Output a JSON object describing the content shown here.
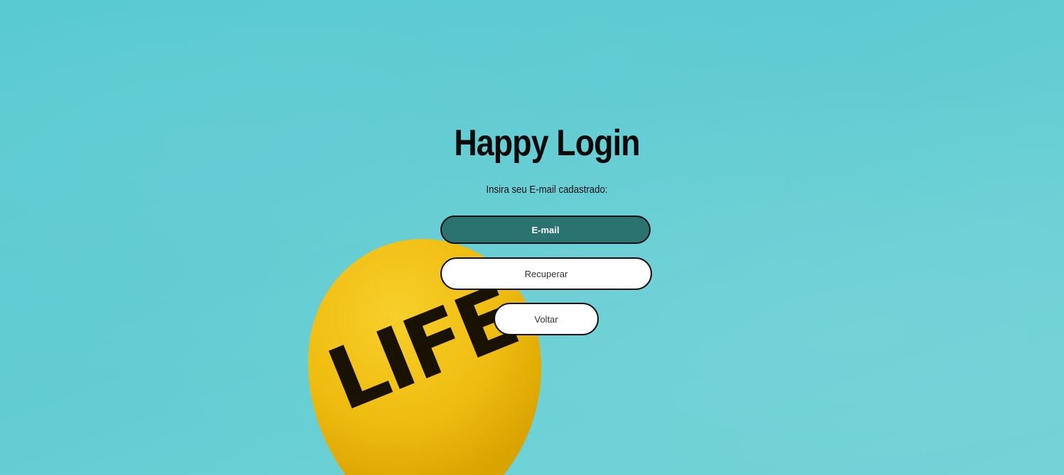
{
  "colors": {
    "background": "#5ccbd2",
    "email_field_bg": "#2a7371",
    "button_bg": "#ffffff",
    "balloon": "#f2c21a",
    "text": "#0a0a0a"
  },
  "background_image": {
    "icon": "yellow-balloon-image",
    "lettering": "LIFE"
  },
  "login": {
    "title": "Happy Login",
    "instruction": "Insira seu E-mail cadastrado:",
    "email_placeholder": "E-mail",
    "email_value": "",
    "recover_label": "Recuperar",
    "back_label": "Voltar"
  }
}
